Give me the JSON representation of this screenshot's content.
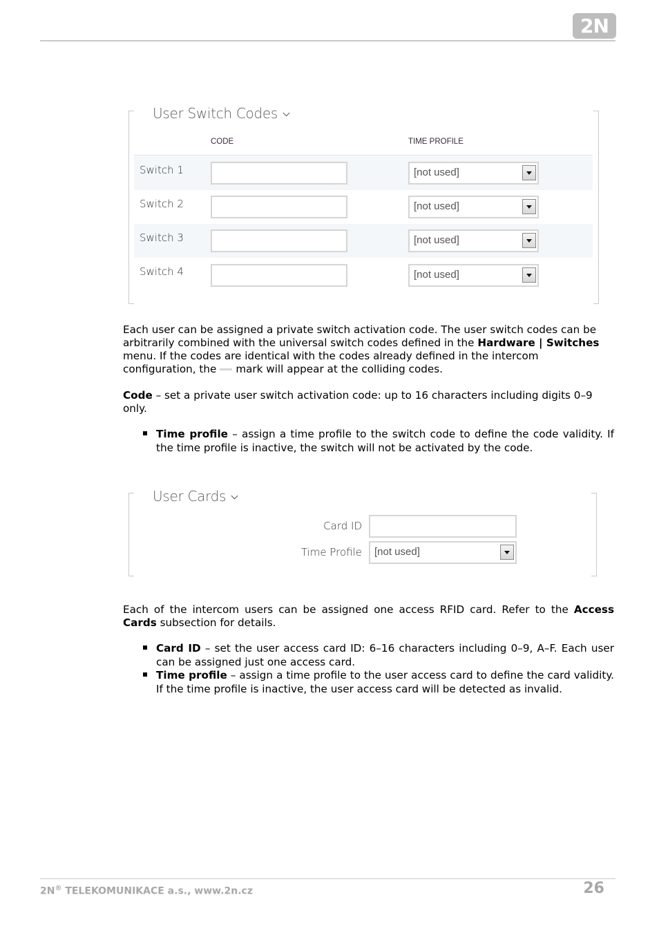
{
  "header": {
    "logo_text": "2N"
  },
  "switch_codes_panel": {
    "title": "User Switch Codes",
    "col_code": "CODE",
    "col_time_profile": "TIME PROFILE",
    "rows": [
      {
        "label": "Switch 1",
        "code": "",
        "time_profile": "[not used]"
      },
      {
        "label": "Switch 2",
        "code": "",
        "time_profile": "[not used]"
      },
      {
        "label": "Switch 3",
        "code": "",
        "time_profile": "[not used]"
      },
      {
        "label": "Switch 4",
        "code": "",
        "time_profile": "[not used]"
      }
    ]
  },
  "para1": {
    "t1": "Each user can be assigned a private switch activation code. The user switch codes can be arbitrarily combined with the universal switch codes defined in the ",
    "b1": "Hardware | Switches",
    "t2": " menu. If the codes are identical with the codes already defined in the intercom configuration, the",
    "t3": "mark will appear at the colliding codes."
  },
  "para2": {
    "b1": "Code",
    "t1": " – set a private user switch activation code: up to 16 characters including digits 0–9 only."
  },
  "bullets1": [
    {
      "bold": "Time profile",
      "text": " – assign a time profile to the switch code to define the code validity. If the time profile is inactive, the switch will not be activated by the code."
    }
  ],
  "user_cards_panel": {
    "title": "User Cards",
    "card_id_label": "Card ID",
    "card_id_value": "",
    "time_profile_label": "Time Profile",
    "time_profile_value": "[not used]"
  },
  "para3": {
    "t1": "Each of the intercom users can be assigned one access RFID card. Refer to the ",
    "b1": "Access Cards",
    "t2": " subsection for details."
  },
  "bullets2": [
    {
      "bold": "Card ID",
      "text": " – set the user access card ID: 6–16 characters including 0–9, A–F. Each user can be assigned just one access card."
    },
    {
      "bold": "Time profile",
      "text": " – assign a time profile to the user access card to define the card validity. If the time profile is inactive, the user access card will be detected as invalid."
    }
  ],
  "footer": {
    "company_prefix": "2N",
    "reg": "®",
    "company_rest": " TELEKOMUNIKACE a.s., www.2n.cz",
    "page_number": "26"
  }
}
